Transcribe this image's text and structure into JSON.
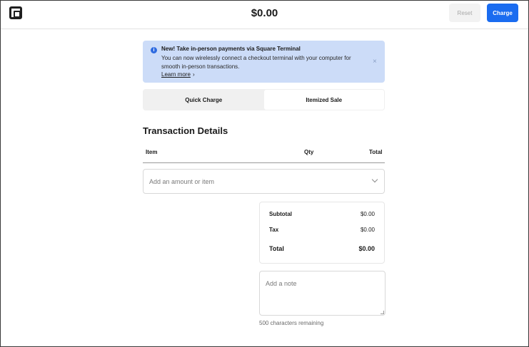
{
  "header": {
    "logo_icon": "square-logo-icon",
    "amount": "$0.00",
    "reset_label": "Reset",
    "charge_label": "Charge"
  },
  "banner": {
    "icon": "info-icon",
    "icon_glyph": "i",
    "title": "New! Take in-person payments via Square Terminal",
    "body": "You can now wirelessly connect a checkout terminal with your computer for smooth in-person transactions.",
    "link": "Learn more",
    "link_chevron": "›",
    "close_glyph": "×"
  },
  "tabs": [
    {
      "label": "Quick Charge",
      "active": false
    },
    {
      "label": "Itemized Sale",
      "active": true
    }
  ],
  "transaction": {
    "title": "Transaction Details",
    "columns": {
      "item": "Item",
      "qty": "Qty",
      "total": "Total"
    },
    "item_placeholder": "Add an amount or item"
  },
  "summary": {
    "subtotal_label": "Subtotal",
    "subtotal_value": "$0.00",
    "tax_label": "Tax",
    "tax_value": "$0.00",
    "total_label": "Total",
    "total_value": "$0.00"
  },
  "note": {
    "placeholder": "Add a note",
    "char_count": "500 characters remaining"
  },
  "colors": {
    "accent": "#1a6cf0",
    "banner_bg": "#ccdcf8"
  }
}
